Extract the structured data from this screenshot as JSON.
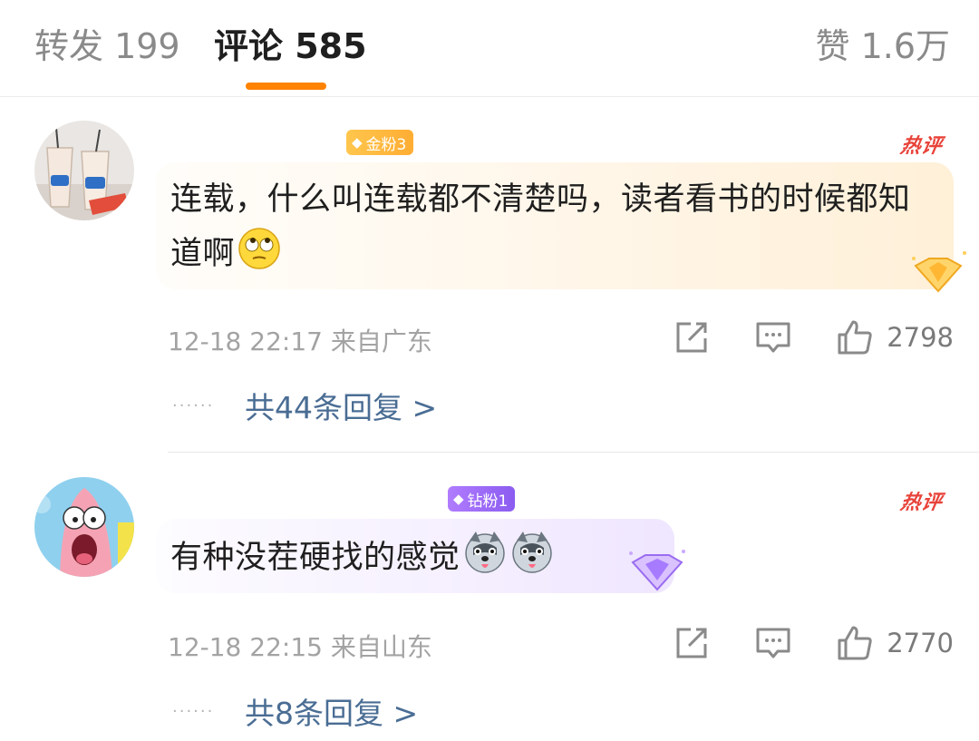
{
  "tabs": {
    "reposts": "转发 199",
    "comments": "评论 585",
    "likes": "赞 1.6万"
  },
  "colors": {
    "accent": "#ff8200",
    "reply_link": "#4a6d94",
    "hot": "#e8433a",
    "gold_badge": "#ffad33",
    "diamond_badge": "#8b5cf0"
  },
  "comments": [
    {
      "badge": "金粉3",
      "hot_tag": "热评",
      "text": "连载，什么叫连载都不清楚吗，读者看书的时候都知道啊",
      "emojis": [
        "eye-roll-emoji"
      ],
      "time": "12-18 22:17",
      "location": "来自广东",
      "likes": "2798",
      "replies": "共44条回复 >"
    },
    {
      "badge": "钻粉1",
      "hot_tag": "热评",
      "text": "有种没茬硬找的感觉",
      "emojis": [
        "husky-emoji",
        "husky-emoji"
      ],
      "time": "12-18 22:15",
      "location": "来自山东",
      "likes": "2770",
      "replies": "共8条回复 >"
    }
  ],
  "icons": {
    "repost": "share-icon",
    "comment": "comment-icon",
    "like": "thumbs-up-icon"
  }
}
